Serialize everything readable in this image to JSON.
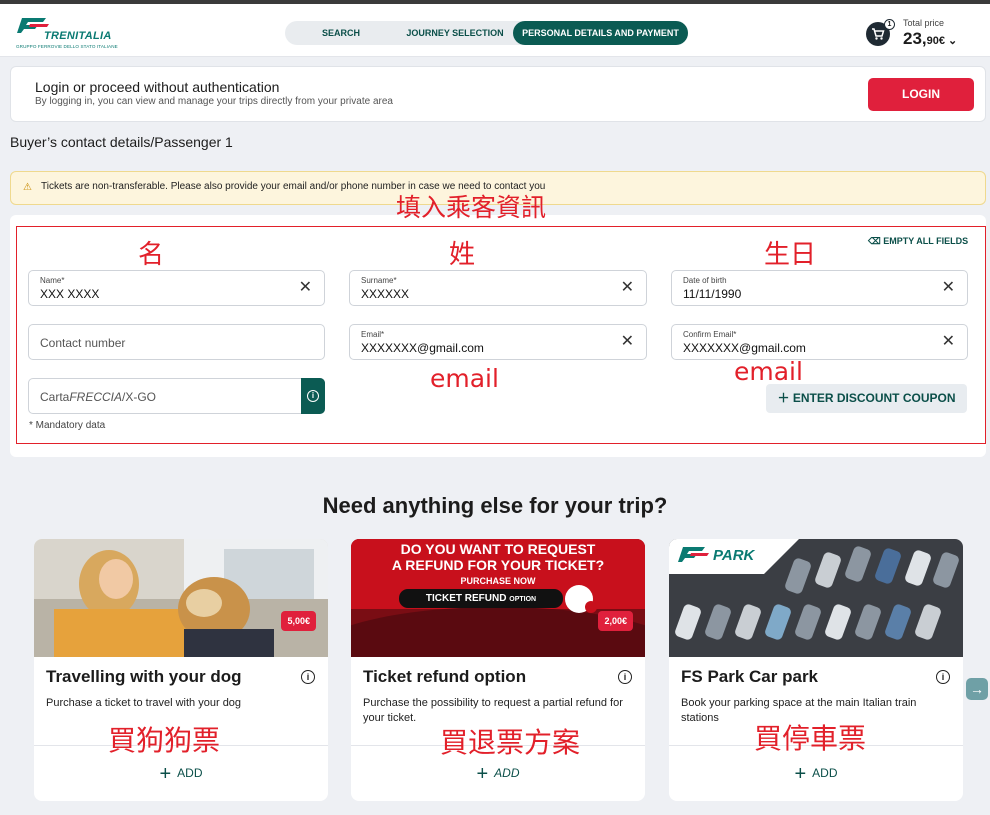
{
  "header": {
    "logo_name": "TRENITALIA",
    "logo_sub": "GRUPPO FERROVIE DELLO STATO ITALIANE",
    "steps": [
      "SEARCH",
      "JOURNEY SELECTION",
      "PERSONAL DETAILS AND PAYMENT"
    ],
    "cart_count": "1",
    "total_label": "Total price",
    "total_main": "23,",
    "total_cents": "90€"
  },
  "login": {
    "title": "Login or proceed without authentication",
    "subtitle": "By logging in, you can view and manage your trips directly from your private area",
    "button": "LOGIN"
  },
  "section_title": "Buyer’s contact details/Passenger 1",
  "alert": "Tickets are non-transferable. Please also provide your email and/or phone number in case we need to contact you",
  "form": {
    "empty_all": "EMPTY ALL FIELDS",
    "name_label": "Name*",
    "name_value": "XXX XXXX",
    "surname_label": "Surname*",
    "surname_value": "XXXXXX",
    "dob_label": "Date of birth",
    "dob_value": "11/11/1990",
    "contact_placeholder": "Contact number",
    "email_label": "Email*",
    "email_value": "XXXXXXX@gmail.com",
    "confirm_label": "Confirm Email*",
    "confirm_value": "XXXXXXX@gmail.com",
    "carta_prefix": "Carta",
    "carta_italic": "FRECCIA",
    "carta_suffix": "/X-GO",
    "mandatory": "* Mandatory data",
    "coupon": "ENTER DISCOUNT COUPON"
  },
  "annotations": {
    "fill_info": "填入乘客資訊",
    "first_name": "名",
    "surname": "姓",
    "birthday": "生日",
    "email1": "email",
    "email2": "email",
    "dog": "買狗狗票",
    "refund": "買退票方案",
    "parking": "買停車票"
  },
  "extras_title": "Need anything else for your trip?",
  "services": [
    {
      "title": "Travelling with your dog",
      "desc": "Purchase a ticket to travel with your dog",
      "price": "5,00€",
      "add": "ADD"
    },
    {
      "title": "Ticket refund option",
      "desc": "Purchase the possibility to request a partial refund for your ticket.",
      "price": "2,00€",
      "add": "ADD",
      "banner1": "DO YOU WANT TO REQUEST",
      "banner2": "A REFUND FOR YOUR TICKET?",
      "banner3": "PURCHASE NOW",
      "banner4": "TICKET REFUND",
      "banner5": "OPTION"
    },
    {
      "title": "FS Park Car park",
      "desc": "Book your parking space at the main Italian train stations",
      "add": "ADD",
      "brand": "PARK"
    }
  ],
  "colors": {
    "brand": "#0b5b53",
    "accent": "#e0203c",
    "annotation": "#e2202a"
  }
}
